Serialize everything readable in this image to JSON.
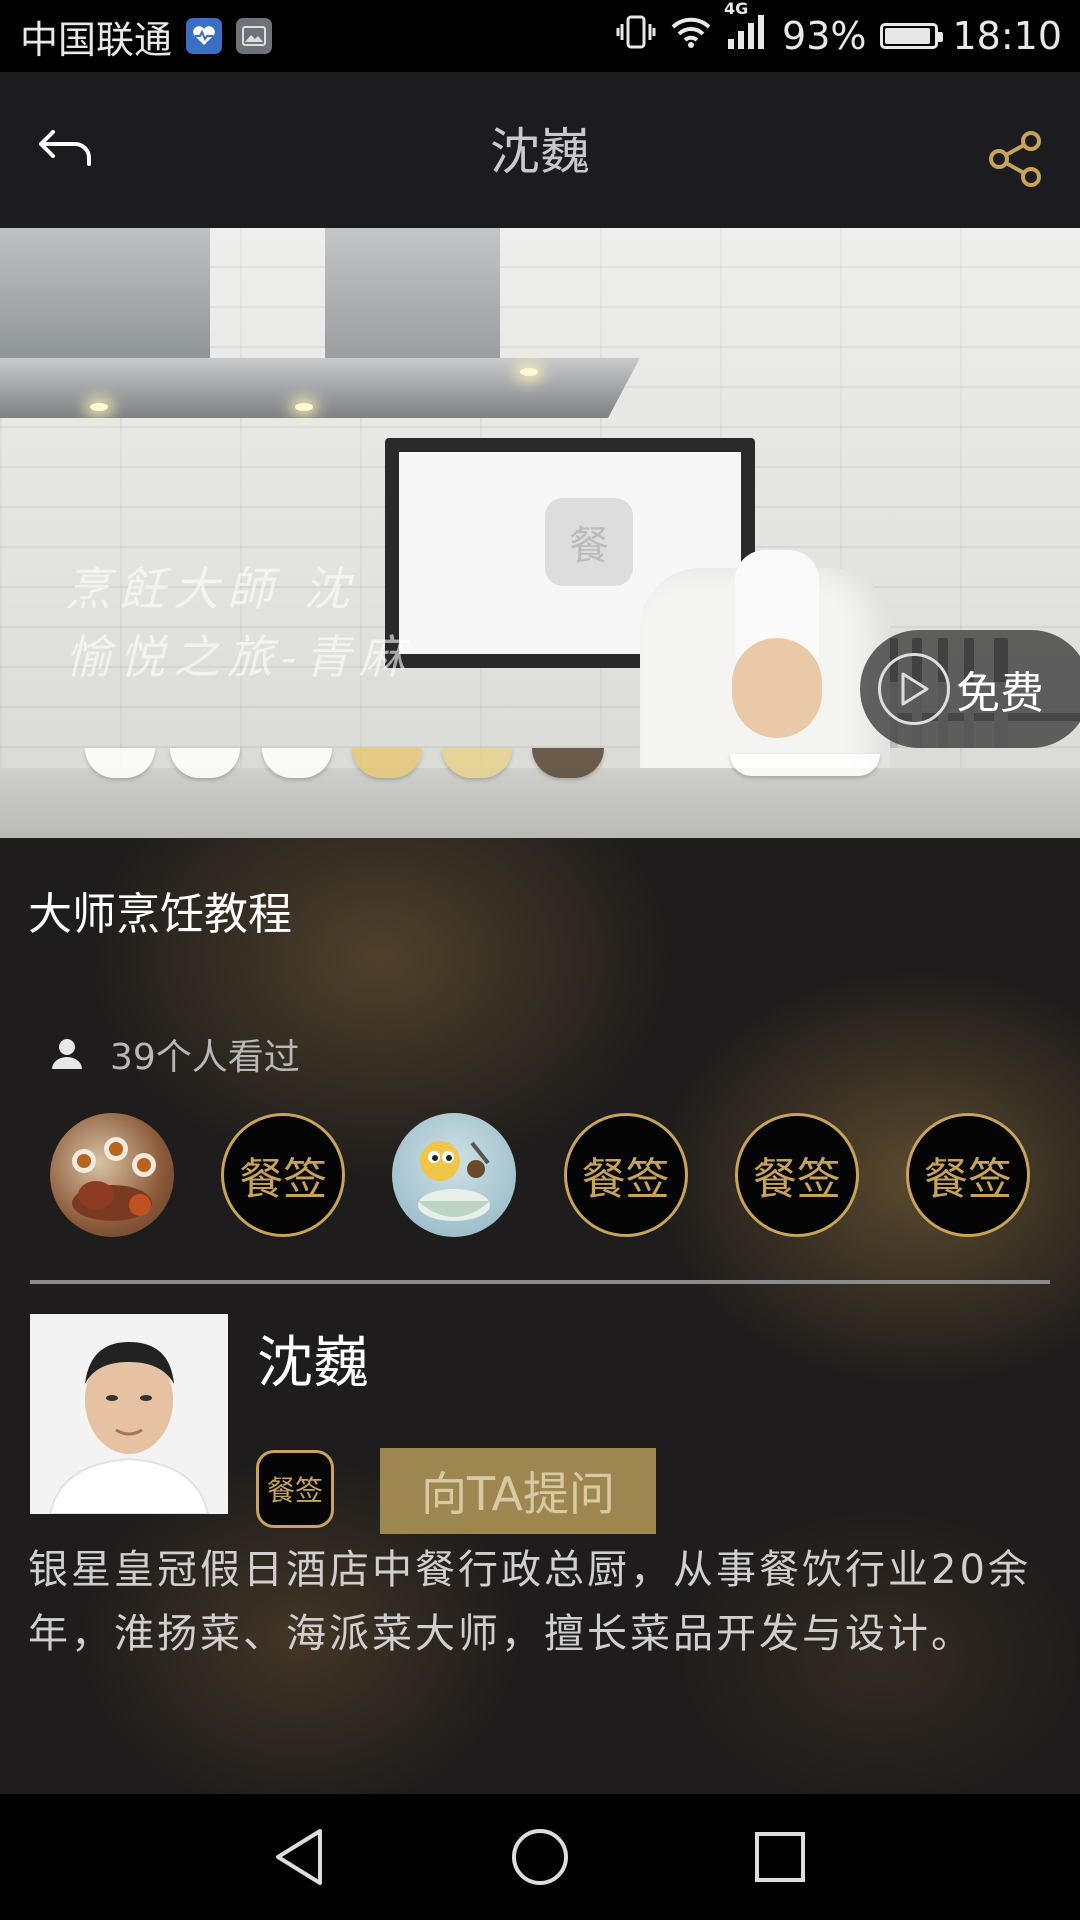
{
  "status_bar": {
    "carrier": "中国联通",
    "network": "4G",
    "battery": "93%",
    "battery_level": 0.93,
    "time": "18:10"
  },
  "header": {
    "title": "沈巍"
  },
  "video": {
    "free_label": "免费",
    "watermark_line1": "烹飪大師 沈",
    "watermark_line2": "愉悦之旅-青麻",
    "tv_logo": "餐"
  },
  "course": {
    "title": "大师烹饪教程",
    "viewers_label": "39个人看过"
  },
  "viewer_avatars": [
    {
      "type": "photo",
      "label": ""
    },
    {
      "type": "logo",
      "label": "餐签"
    },
    {
      "type": "cartoon",
      "label": ""
    },
    {
      "type": "logo",
      "label": "餐签"
    },
    {
      "type": "logo",
      "label": "餐签"
    },
    {
      "type": "logo",
      "label": "餐签"
    }
  ],
  "profile": {
    "name": "沈巍",
    "badge": "餐签",
    "ask_button": "向TA提问",
    "bio": "银星皇冠假日酒店中餐行政总厨，从事餐饮行业20余年，淮扬菜、海派菜大师，擅长菜品开发与设计。"
  },
  "colors": {
    "accent_gold": "#c8a45a",
    "ask_button_bg": "#9d8650",
    "header_bg": "#1b1b20"
  }
}
